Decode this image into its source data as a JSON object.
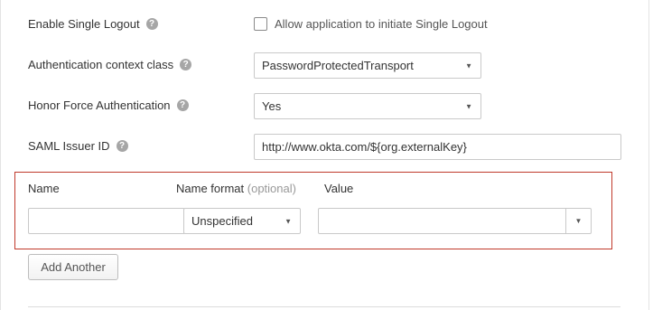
{
  "fields": {
    "single_logout": {
      "label": "Enable Single Logout",
      "help": "?",
      "checkbox_label": "Allow application to initiate Single Logout",
      "checked": false
    },
    "auth_context": {
      "label": "Authentication context class",
      "help": "?",
      "value": "PasswordProtectedTransport"
    },
    "force_auth": {
      "label": "Honor Force Authentication",
      "help": "?",
      "value": "Yes"
    },
    "issuer": {
      "label": "SAML Issuer ID",
      "help": "?",
      "value": "http://www.okta.com/${org.externalKey}"
    }
  },
  "attributes": {
    "col_name": "Name",
    "col_format": "Name format",
    "col_format_hint": "(optional)",
    "col_value": "Value",
    "row": {
      "name": "",
      "format": "Unspecified",
      "value": ""
    },
    "add_another": "Add Another"
  },
  "colors": {
    "highlight_border": "#c0392b",
    "help_icon": "#a6a6a6"
  }
}
